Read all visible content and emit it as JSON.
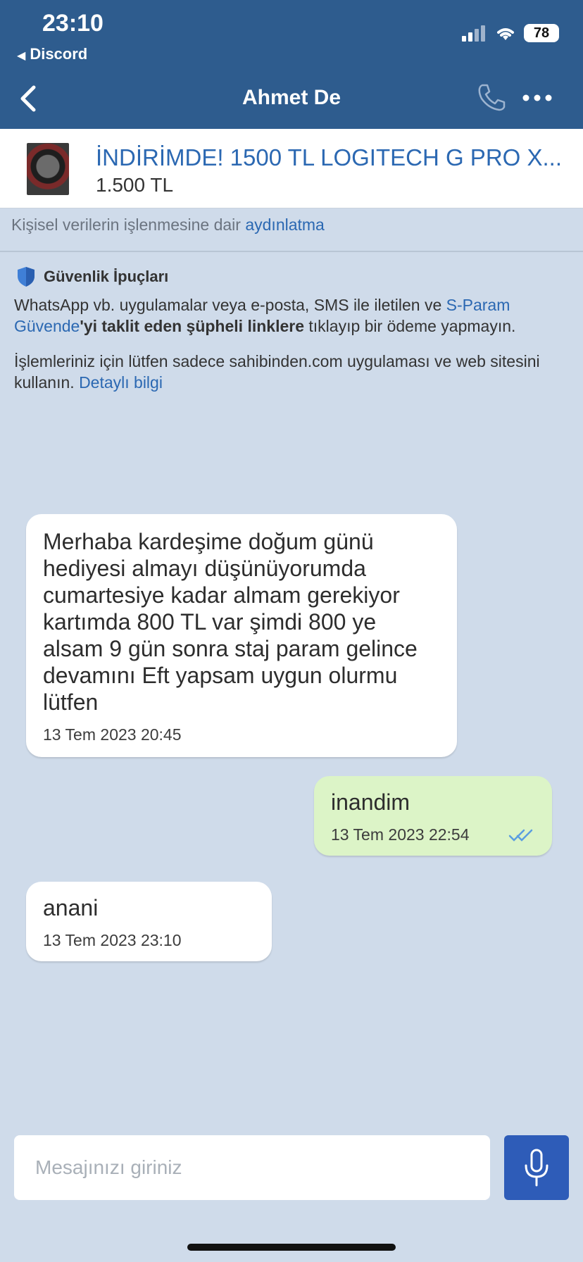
{
  "status": {
    "time": "23:10",
    "back_app": "Discord",
    "battery": "78"
  },
  "nav": {
    "title": "Ahmet De"
  },
  "listing": {
    "title": "İNDİRİMDE! 1500 TL LOGITECH G PRO X...",
    "price": "1.500 TL"
  },
  "privacy": {
    "text": "Kişisel verilerin işlenmesine dair",
    "link": "aydınlatma"
  },
  "security": {
    "title": "Güvenlik İpuçları",
    "p1_a": "WhatsApp vb. uygulamalar veya e-posta, SMS ile iletilen ve",
    "p1_link": "S-Param Güvende",
    "p1_bold": "'yi taklit eden şüpheli linklere",
    "p1_c": "tıklayıp bir ödeme yapmayın.",
    "p2": "İşlemleriniz için lütfen sadece sahibinden.com uygulaması ve web sitesini kullanın.",
    "p2_link": "Detaylı bilgi"
  },
  "messages": [
    {
      "direction": "incoming",
      "text": "Merhaba kardeşime doğum günü hediyesi almayı düşünüyorumda cumartesiye kadar almam gerekiyor kartımda 800 TL var şimdi 800 ye alsam 9 gün sonra staj param gelince devamını Eft yapsam uygun olurmu lütfen",
      "time": "13 Tem 2023 20:45"
    },
    {
      "direction": "outgoing",
      "text": "inandim",
      "time": "13 Tem 2023 22:54",
      "status": "read"
    },
    {
      "direction": "incoming",
      "text": "anani",
      "time": "13 Tem 2023 23:10"
    }
  ],
  "composer": {
    "placeholder": "Mesajınızı giriniz"
  },
  "colors": {
    "header": "#2e5c8e",
    "link": "#2b68b2",
    "outgoing_bubble": "#dcf4c7",
    "background": "#cfdbea",
    "mic_button": "#2e5cb8"
  },
  "icons": {
    "back": "chevron-left-icon",
    "call": "phone-icon",
    "more": "more-dots-icon",
    "security": "shield-icon",
    "read": "double-check-icon",
    "mic": "microphone-icon"
  }
}
